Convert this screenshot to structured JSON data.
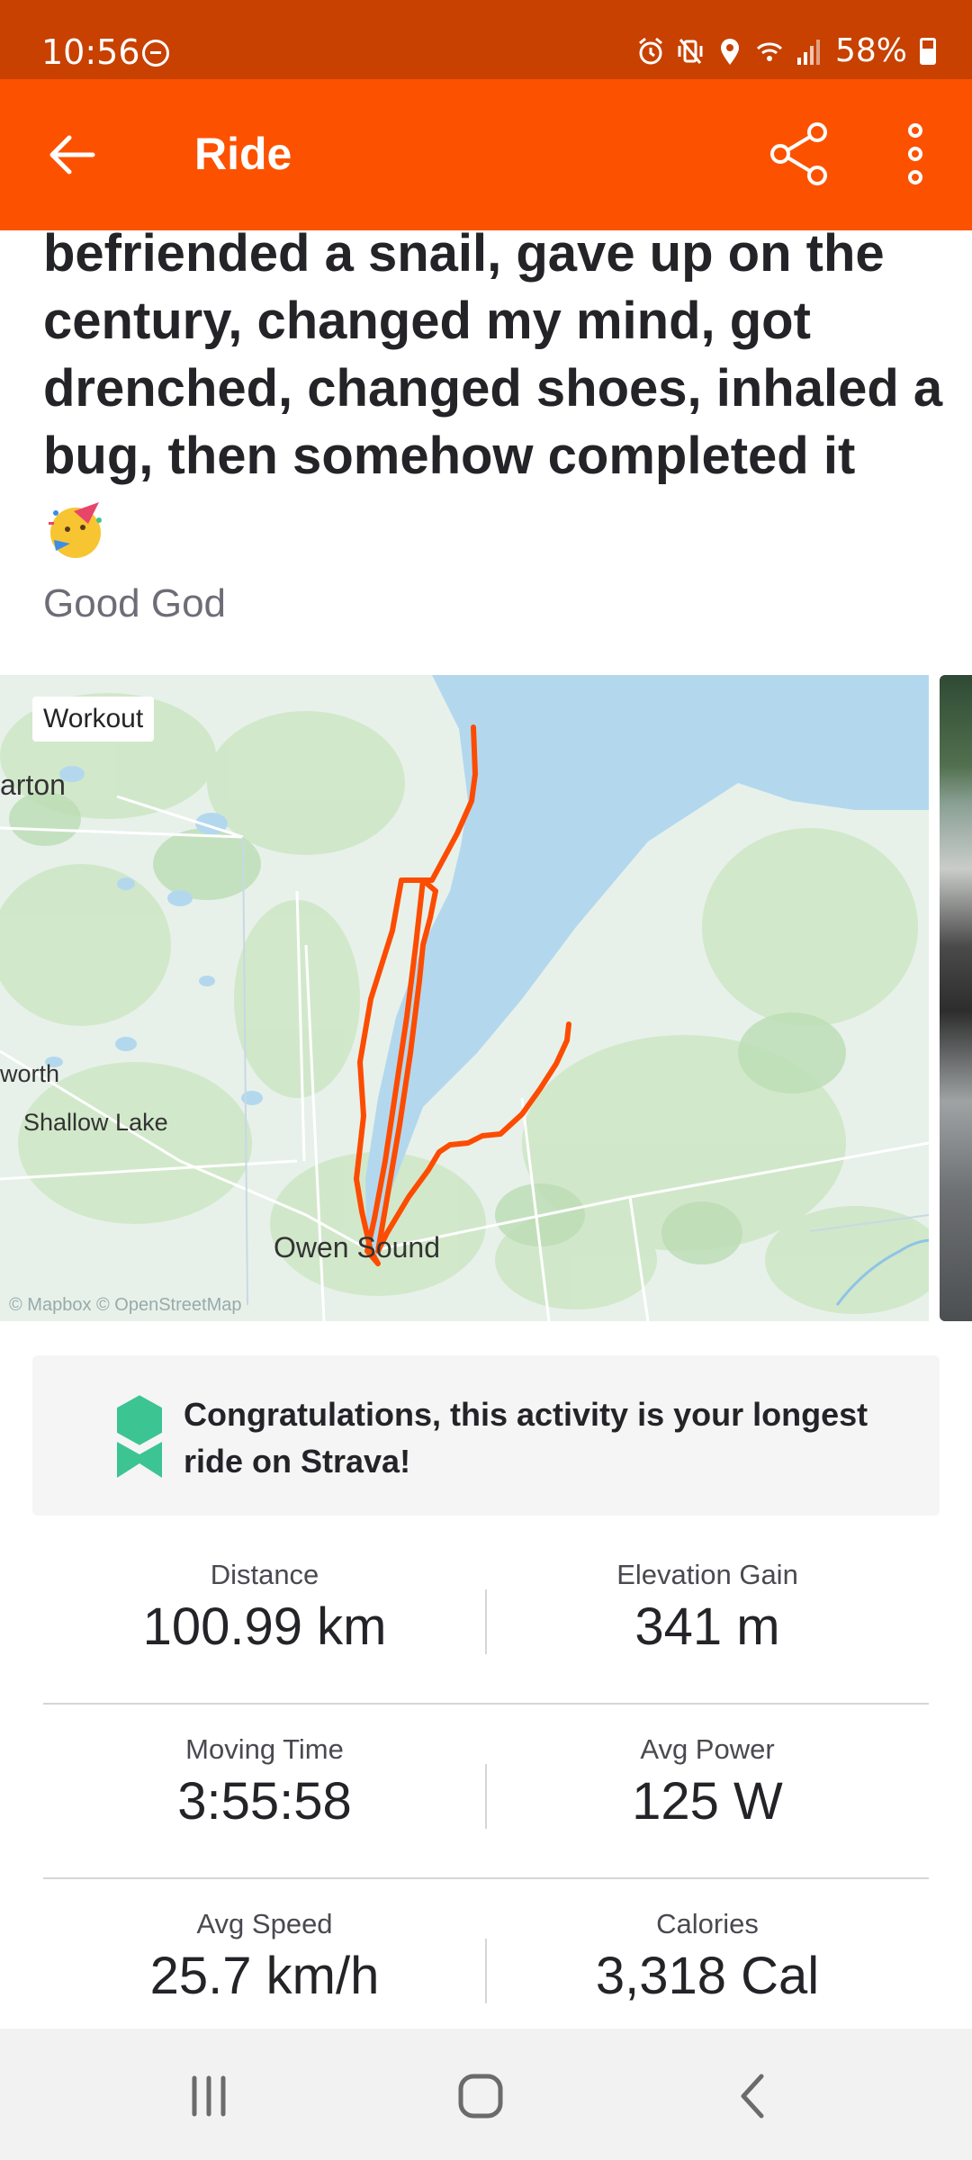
{
  "status_bar": {
    "time": "10:56",
    "battery": "58%",
    "icons": [
      "alarm-icon",
      "vibrate-mute-icon",
      "location-icon",
      "wifi-icon",
      "signal-icon",
      "battery-icon"
    ]
  },
  "app_bar": {
    "title": "Ride",
    "back_icon": "arrow-left-icon",
    "share_icon": "share-icon",
    "more_icon": "more-vertical-icon",
    "color": "#fc5200"
  },
  "activity": {
    "description": "befriended a snail, gave up on the century, changed my mind, got drenched, changed shoes, inhaled a bug, then somehow completed it",
    "emoji": "🥳",
    "subtitle": "Good God"
  },
  "map": {
    "badge": "Workout",
    "labels": {
      "arton": "arton",
      "worth": "worth",
      "shallow_lake": "Shallow Lake",
      "owen_sound": "Owen Sound"
    },
    "attribution": "© Mapbox © OpenStreetMap",
    "route_color": "#fc4c02"
  },
  "achievement": {
    "text": "Congratulations, this activity is your longest ride on Strava!",
    "icon": "medal-icon",
    "icon_color": "#3cc492"
  },
  "stats": [
    {
      "label": "Distance",
      "value": "100.99 km"
    },
    {
      "label": "Elevation Gain",
      "value": "341 m"
    },
    {
      "label": "Moving Time",
      "value": "3:55:58"
    },
    {
      "label": "Avg Power",
      "value": "125 W"
    },
    {
      "label": "Avg Speed",
      "value": "25.7 km/h"
    },
    {
      "label": "Calories",
      "value": "3,318 Cal"
    }
  ],
  "nav_bar": {
    "buttons": [
      "recents-icon",
      "home-icon",
      "back-icon"
    ]
  }
}
